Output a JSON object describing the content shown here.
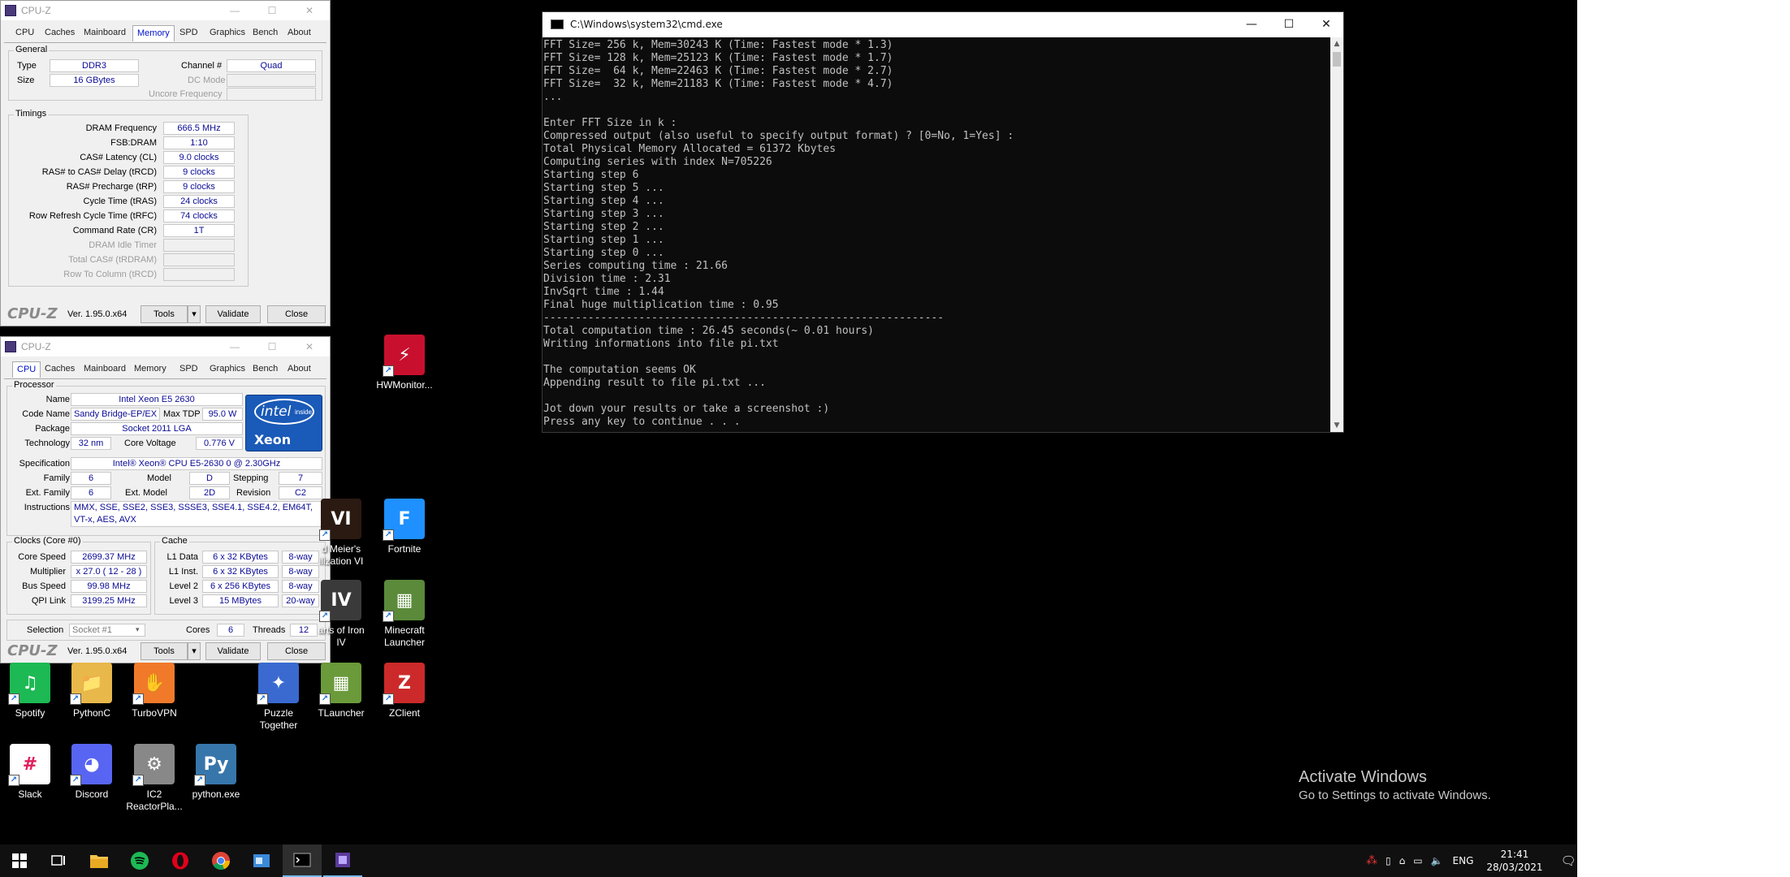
{
  "cpuz_memory": {
    "title": "CPU-Z",
    "tabs": [
      "CPU",
      "Caches",
      "Mainboard",
      "Memory",
      "SPD",
      "Graphics",
      "Bench",
      "About"
    ],
    "active_tab": "Memory",
    "general": {
      "title": "General",
      "type_label": "Type",
      "type_value": "DDR3",
      "size_label": "Size",
      "size_value": "16 GBytes",
      "channel_label": "Channel #",
      "channel_value": "Quad",
      "dcmode_label": "DC Mode",
      "uncore_label": "Uncore Frequency"
    },
    "timings": {
      "title": "Timings",
      "rows": [
        {
          "label": "DRAM Frequency",
          "value": "666.5 MHz"
        },
        {
          "label": "FSB:DRAM",
          "value": "1:10"
        },
        {
          "label": "CAS# Latency (CL)",
          "value": "9.0 clocks"
        },
        {
          "label": "RAS# to CAS# Delay (tRCD)",
          "value": "9 clocks"
        },
        {
          "label": "RAS# Precharge (tRP)",
          "value": "9 clocks"
        },
        {
          "label": "Cycle Time (tRAS)",
          "value": "24 clocks"
        },
        {
          "label": "Row Refresh Cycle Time (tRFC)",
          "value": "74 clocks"
        },
        {
          "label": "Command Rate (CR)",
          "value": "1T"
        },
        {
          "label": "DRAM Idle Timer",
          "value": ""
        },
        {
          "label": "Total CAS# (tRDRAM)",
          "value": ""
        },
        {
          "label": "Row To Column (tRCD)",
          "value": ""
        }
      ]
    },
    "footer": {
      "brand": "CPU-Z",
      "version": "Ver. 1.95.0.x64",
      "tools": "Tools",
      "validate": "Validate",
      "close": "Close"
    }
  },
  "cpuz_cpu": {
    "title": "CPU-Z",
    "tabs": [
      "CPU",
      "Caches",
      "Mainboard",
      "Memory",
      "SPD",
      "Graphics",
      "Bench",
      "About"
    ],
    "active_tab": "CPU",
    "processor": {
      "title": "Processor",
      "name_label": "Name",
      "name_value": "Intel Xeon E5 2630",
      "codename_label": "Code Name",
      "codename_value": "Sandy Bridge-EP/EX",
      "maxtdp_label": "Max TDP",
      "maxtdp_value": "95.0 W",
      "package_label": "Package",
      "package_value": "Socket 2011 LGA",
      "technology_label": "Technology",
      "technology_value": "32 nm",
      "corevoltage_label": "Core Voltage",
      "corevoltage_value": "0.776 V",
      "spec_label": "Specification",
      "spec_value": "Intel® Xeon® CPU E5-2630 0 @ 2.30GHz",
      "family_label": "Family",
      "family_value": "6",
      "model_label": "Model",
      "model_value": "D",
      "stepping_label": "Stepping",
      "stepping_value": "7",
      "extfamily_label": "Ext. Family",
      "extfamily_value": "6",
      "extmodel_label": "Ext. Model",
      "extmodel_value": "2D",
      "revision_label": "Revision",
      "revision_value": "C2",
      "instructions_label": "Instructions",
      "instructions_value": "MMX, SSE, SSE2, SSE3, SSSE3, SSE4.1, SSE4.2, EM64T, VT-x, AES, AVX",
      "logo_top": "intel",
      "logo_inside": "inside",
      "logo_brand": "Xeon"
    },
    "clocks": {
      "title": "Clocks (Core #0)",
      "corespeed_label": "Core Speed",
      "corespeed_value": "2699.37 MHz",
      "multiplier_label": "Multiplier",
      "multiplier_value": "x 27.0 ( 12 - 28 )",
      "busspeed_label": "Bus Speed",
      "busspeed_value": "99.98 MHz",
      "qpi_label": "QPI Link",
      "qpi_value": "3199.25 MHz"
    },
    "cache": {
      "title": "Cache",
      "rows": [
        {
          "label": "L1 Data",
          "value": "6 x 32 KBytes",
          "way": "8-way"
        },
        {
          "label": "L1 Inst.",
          "value": "6 x 32 KBytes",
          "way": "8-way"
        },
        {
          "label": "Level 2",
          "value": "6 x 256 KBytes",
          "way": "8-way"
        },
        {
          "label": "Level 3",
          "value": "15 MBytes",
          "way": "20-way"
        }
      ]
    },
    "selection": {
      "label": "Selection",
      "value": "Socket #1",
      "cores_label": "Cores",
      "cores_value": "6",
      "threads_label": "Threads",
      "threads_value": "12"
    },
    "footer": {
      "brand": "CPU-Z",
      "version": "Ver. 1.95.0.x64",
      "tools": "Tools",
      "validate": "Validate",
      "close": "Close"
    }
  },
  "cmd": {
    "title": "C:\\Windows\\system32\\cmd.exe",
    "lines": [
      "FFT Size= 256 k, Mem=30243 K (Time: Fastest mode * 1.3)",
      "FFT Size= 128 k, Mem=25123 K (Time: Fastest mode * 1.7)",
      "FFT Size=  64 k, Mem=22463 K (Time: Fastest mode * 2.7)",
      "FFT Size=  32 k, Mem=21183 K (Time: Fastest mode * 4.7)",
      "...",
      "",
      "Enter FFT Size in k :",
      "Compressed output (also useful to specify output format) ? [0=No, 1=Yes] :",
      "Total Physical Memory Allocated = 61372 Kbytes",
      "Computing series with index N=705226",
      "Starting step 6",
      "Starting step 5 ...",
      "Starting step 4 ...",
      "Starting step 3 ...",
      "Starting step 2 ...",
      "Starting step 1 ...",
      "Starting step 0 ...",
      "Series computing time : 21.66",
      "Division time : 2.31",
      "InvSqrt time : 1.44",
      "Final huge multiplication time : 0.95",
      "---------------------------------------------------------------",
      "Total computation time : 26.45 seconds(~ 0.01 hours)",
      "Writing informations into file pi.txt",
      "",
      "The computation seems OK",
      "Appending result to file pi.txt ...",
      "",
      "Jot down your results or take a screenshot :)",
      "Press any key to continue . . ."
    ]
  },
  "desktop_icons": [
    {
      "name": "HWMonitor...",
      "color": "#c8102e",
      "glyph": "⚡"
    },
    {
      "name": "d Meier's\nilization VI",
      "color": "#2b1a12",
      "glyph": "VI"
    },
    {
      "name": "Fortnite",
      "color": "#1e90ff",
      "glyph": "F"
    },
    {
      "name": "arts of Iron\nIV",
      "color": "#3a3a3a",
      "glyph": "IV"
    },
    {
      "name": "Minecraft\nLauncher",
      "color": "#5a8a3a",
      "glyph": "▦"
    },
    {
      "name": "Spotify",
      "color": "#1db954",
      "glyph": "♫"
    },
    {
      "name": "PythonC",
      "color": "#e8b84a",
      "glyph": "📁"
    },
    {
      "name": "TurboVPN",
      "color": "#f07a2a",
      "glyph": "✋"
    },
    {
      "name": "Puzzle\nTogether",
      "color": "#3a6ad0",
      "glyph": "✦"
    },
    {
      "name": "TLauncher",
      "color": "#6a9a3a",
      "glyph": "▦"
    },
    {
      "name": "ZClient",
      "color": "#cc2a2a",
      "glyph": "Z"
    },
    {
      "name": "Slack",
      "color": "#ffffff",
      "glyph": "#"
    },
    {
      "name": "Discord",
      "color": "#5865f2",
      "glyph": "◕"
    },
    {
      "name": "IC2\nReactorPla...",
      "color": "#888888",
      "glyph": "⚙"
    },
    {
      "name": "python.exe",
      "color": "#3776ab",
      "glyph": "Py"
    }
  ],
  "watermark": {
    "line1": "Activate Windows",
    "line2": "Go to Settings to activate Windows."
  },
  "taskbar": {
    "lang": "ENG",
    "time": "21:41",
    "date": "28/03/2021"
  }
}
